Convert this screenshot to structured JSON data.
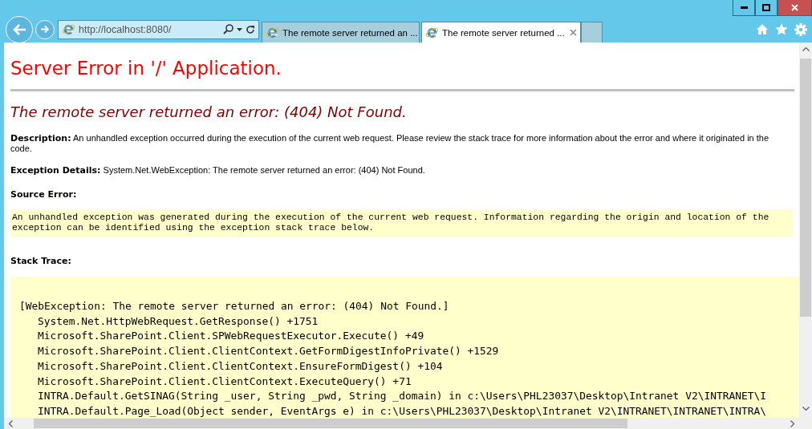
{
  "browser": {
    "address": "http://localhost:8080/",
    "tabs": [
      {
        "title": "The remote server returned an ...",
        "selected": false
      },
      {
        "title": "The remote server returned ...",
        "selected": true
      }
    ]
  },
  "page": {
    "title": "Server Error in '/' Application.",
    "error_heading": "The remote server returned an error: (404) Not Found.",
    "description": {
      "label": "Description:",
      "text": "An unhandled exception occurred during the execution of the current web request. Please review the stack trace for more information about the error and where it originated in the code."
    },
    "exception_details": {
      "label": "Exception Details:",
      "text": "System.Net.WebException: The remote server returned an error: (404) Not Found."
    },
    "source_error": {
      "label": "Source Error:",
      "lines": [
        "An unhandled exception was generated during the execution of the current web request. Information regarding the origin and location of the",
        "exception can be identified using the exception stack trace below."
      ]
    },
    "stack_trace": {
      "label": "Stack Trace:",
      "exception": "[WebException: The remote server returned an error: (404) Not Found.]",
      "frames": [
        "System.Net.HttpWebRequest.GetResponse() +1751",
        "Microsoft.SharePoint.Client.SPWebRequestExecutor.Execute() +49",
        "Microsoft.SharePoint.Client.ClientContext.GetFormDigestInfoPrivate() +1529",
        "Microsoft.SharePoint.Client.ClientContext.EnsureFormDigest() +104",
        "Microsoft.SharePoint.Client.ClientContext.ExecuteQuery() +71",
        "INTRA.Default.GetSINAG(String _user, String _pwd, String _domain) in c:\\Users\\PHL23037\\Desktop\\Intranet V2\\INTRANET\\I",
        "INTRA.Default.Page_Load(Object sender, EventArgs e) in c:\\Users\\PHL23037\\Desktop\\Intranet V2\\INTRANET\\INTRANET\\INTRA\\"
      ]
    }
  }
}
